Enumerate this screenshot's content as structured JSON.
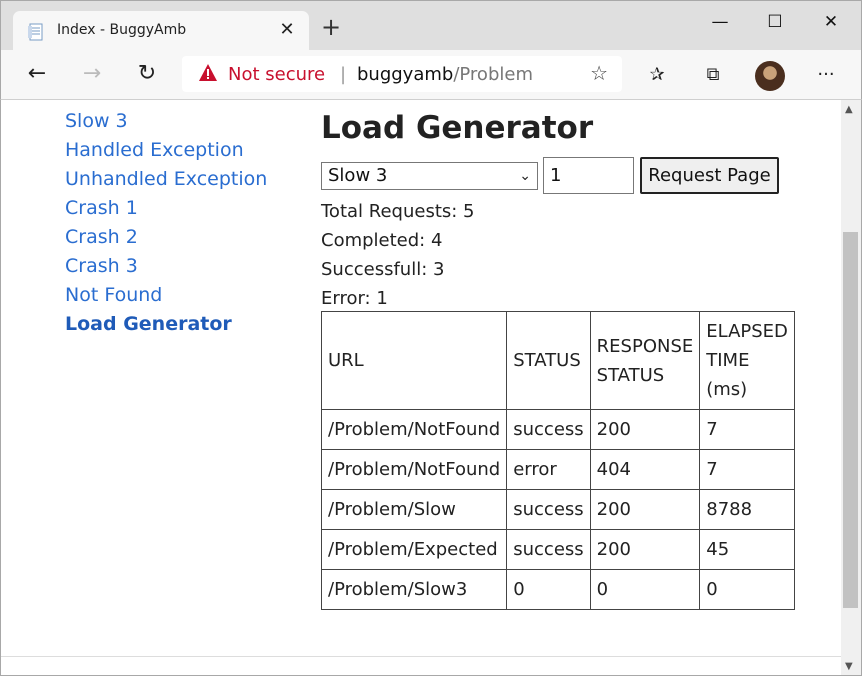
{
  "browser": {
    "tab_title": "Index - BuggyAmb",
    "new_tab": "+",
    "address": {
      "security_label": "Not secure",
      "separator": "|",
      "host": "buggyamb",
      "path": "/Problem"
    }
  },
  "sidebar": {
    "items": [
      {
        "label": "Slow 3"
      },
      {
        "label": "Handled Exception"
      },
      {
        "label": "Unhandled Exception"
      },
      {
        "label": "Crash 1"
      },
      {
        "label": "Crash 2"
      },
      {
        "label": "Crash 3"
      },
      {
        "label": "Not Found"
      },
      {
        "label": "Load Generator"
      }
    ]
  },
  "main": {
    "title": "Load Generator",
    "select_value": "Slow 3",
    "count_value": "1",
    "request_button": "Request Page",
    "stats": {
      "total": "Total Requests: 5",
      "completed": "Completed: 4",
      "successful": "Successfull: 3",
      "error": "Error: 1"
    },
    "table": {
      "headers": [
        "URL",
        "STATUS",
        "RESPONSE STATUS",
        "ELAPSED TIME (ms)"
      ],
      "rows": [
        [
          "/Problem/NotFound",
          "success",
          "200",
          "7"
        ],
        [
          "/Problem/NotFound",
          "error",
          "404",
          "7"
        ],
        [
          "/Problem/Slow",
          "success",
          "200",
          "8788"
        ],
        [
          "/Problem/Expected",
          "success",
          "200",
          "45"
        ],
        [
          "/Problem/Slow3",
          "0",
          "0",
          "0"
        ]
      ]
    }
  }
}
